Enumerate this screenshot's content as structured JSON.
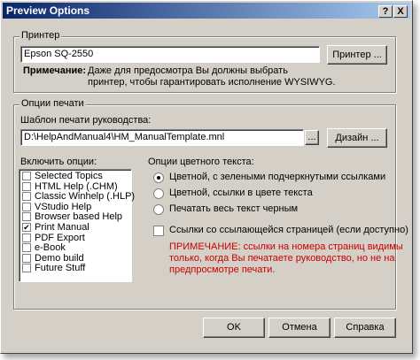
{
  "window": {
    "title": "Preview Options",
    "help_btn": "?",
    "close_btn": "X"
  },
  "printer_group": {
    "label": "Принтер",
    "printer_name": "Epson SQ-2550",
    "printer_button": "Принтер ...",
    "note_label": "Примечание:",
    "note_text_line1": "Даже для предосмотра Вы должны выбрать",
    "note_text_line2": "принтер, чтобы гарантировать исполнение WYSIWYG."
  },
  "print_options_group": {
    "label": "Опции печати",
    "template_label": "Шаблон печати руководства:",
    "template_path": "D:\\HelpAndManual4\\HM_ManualTemplate.mnl",
    "browse_button": "...",
    "design_button": "Дизайн ...",
    "include_label": "Включить опции:",
    "include_items": [
      {
        "label": "Selected Topics",
        "checked": false
      },
      {
        "label": "HTML Help (.CHM)",
        "checked": false
      },
      {
        "label": "Classic Winhelp (.HLP)",
        "checked": false
      },
      {
        "label": "VStudio Help",
        "checked": false
      },
      {
        "label": "Browser based Help",
        "checked": false
      },
      {
        "label": "Print Manual",
        "checked": true
      },
      {
        "label": "PDF Export",
        "checked": false
      },
      {
        "label": "e-Book",
        "checked": false
      },
      {
        "label": "Demo build",
        "checked": false
      },
      {
        "label": "Future Stuff",
        "checked": false
      }
    ],
    "color_label": "Опции цветного текста:",
    "color_options": [
      {
        "label": "Цветной, с зелеными подчеркнутыми ссылками",
        "selected": true
      },
      {
        "label": "Цветной, ссылки в цвете текста",
        "selected": false
      },
      {
        "label": "Печатать весь текст черным",
        "selected": false
      }
    ],
    "page_ref_checkbox": "Ссылки со ссылающейся страницей (если доступно)",
    "page_ref_checked": false,
    "warning_line1": "ПРИМЕЧАНИЕ: ссылки на номера страниц видимы",
    "warning_line2": "только, когда Вы печатаете руководство, но не на",
    "warning_line3": "предпросмотре печати."
  },
  "buttons": {
    "ok": "OK",
    "cancel": "Отмена",
    "help": "Справка"
  },
  "colors": {
    "dialog_bg": "#d4d0c8",
    "title_start": "#0a246a",
    "title_end": "#a6caf0",
    "warning": "#cc0000"
  }
}
